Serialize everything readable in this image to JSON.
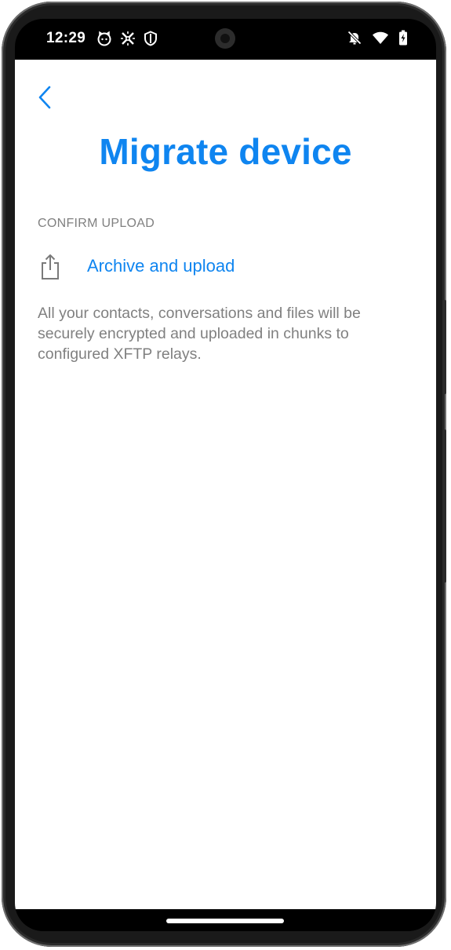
{
  "status_bar": {
    "time": "12:29",
    "left_icons": [
      "cat-face-icon",
      "network-cross-icon",
      "shield-icon"
    ],
    "right_icons": [
      "muted-bell-icon",
      "wifi-icon",
      "battery-charging-icon"
    ]
  },
  "header": {
    "back_icon": "chevron-left-icon",
    "title": "Migrate device"
  },
  "section": {
    "header": "CONFIRM UPLOAD",
    "action_icon": "share-upload-icon",
    "action_label": "Archive and upload",
    "description": "All your contacts, conversations and files will be securely encrypted and uploaded in chunks to configured XFTP relays."
  },
  "colors": {
    "accent": "#0f85f0",
    "secondary_text": "#808080",
    "background": "#ffffff"
  }
}
